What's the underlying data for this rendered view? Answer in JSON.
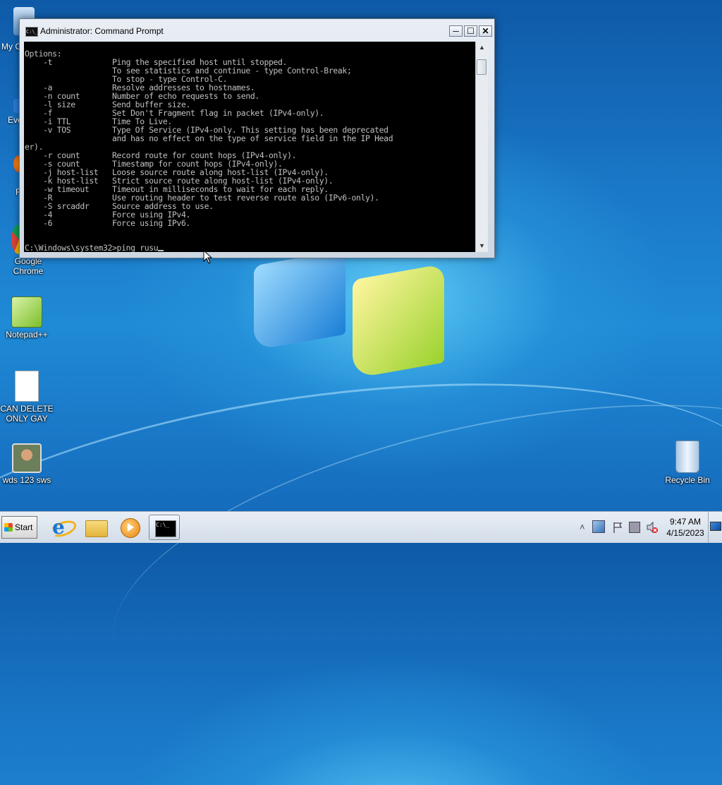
{
  "window": {
    "title": "Administrator: Command Prompt",
    "icon_label": "C:\\_",
    "minimize_glyph": "─",
    "maximize_glyph": "☐",
    "close_glyph": "✕",
    "console_output": "Options:\n    -t             Ping the specified host until stopped.\n                   To see statistics and continue - type Control-Break;\n                   To stop - type Control-C.\n    -a             Resolve addresses to hostnames.\n    -n count       Number of echo requests to send.\n    -l size        Send buffer size.\n    -f             Set Don't Fragment flag in packet (IPv4-only).\n    -i TTL         Time To Live.\n    -v TOS         Type Of Service (IPv4-only. This setting has been deprecated\n                   and has no effect on the type of service field in the IP Head\ner).\n    -r count       Record route for count hops (IPv4-only).\n    -s count       Timestamp for count hops (IPv4-only).\n    -j host-list   Loose source route along host-list (IPv4-only).\n    -k host-list   Strict source route along host-list (IPv4-only).\n    -w timeout     Timeout in milliseconds to wait for each reply.\n    -R             Use routing header to test reverse route also (IPv6-only).\n    -S srcaddr     Source address to use.\n    -4             Force using IPv4.\n    -6             Force using IPv6.",
    "prompt_line": "C:\\Windows\\system32>ping rusu",
    "scroll_up_glyph": "▲",
    "scroll_down_glyph": "▼"
  },
  "desktop": {
    "icons": [
      {
        "label": "My C",
        "icon": "computer-icon"
      },
      {
        "label": "Eve",
        "icon": "shortcut-icon"
      },
      {
        "label": "F",
        "icon": "firefox-icon"
      },
      {
        "label": "Google Chrome",
        "icon": "chrome-icon"
      },
      {
        "label": "Notepad++",
        "icon": "notepad-plus-plus-icon"
      },
      {
        "label": "CAN DELETE ONLY GAY",
        "icon": "text-file-icon"
      },
      {
        "label": "wds 123 sws",
        "icon": "user-icon"
      },
      {
        "label": "Recycle Bin",
        "icon": "recycle-bin-icon"
      }
    ]
  },
  "taskbar": {
    "start_label": "Start",
    "apps": [
      "internet-explorer-icon",
      "windows-explorer-icon",
      "media-player-icon",
      "command-prompt-icon"
    ],
    "cmd_icon_text": "C:\\_",
    "tray": {
      "expand_glyph": "˄"
    },
    "clock_time": "9:47 AM",
    "clock_date": "4/15/2023"
  },
  "colors": {
    "console_bg": "#000000",
    "console_text": "#c0c0c0",
    "desktop_blue": "#1a78c8"
  }
}
